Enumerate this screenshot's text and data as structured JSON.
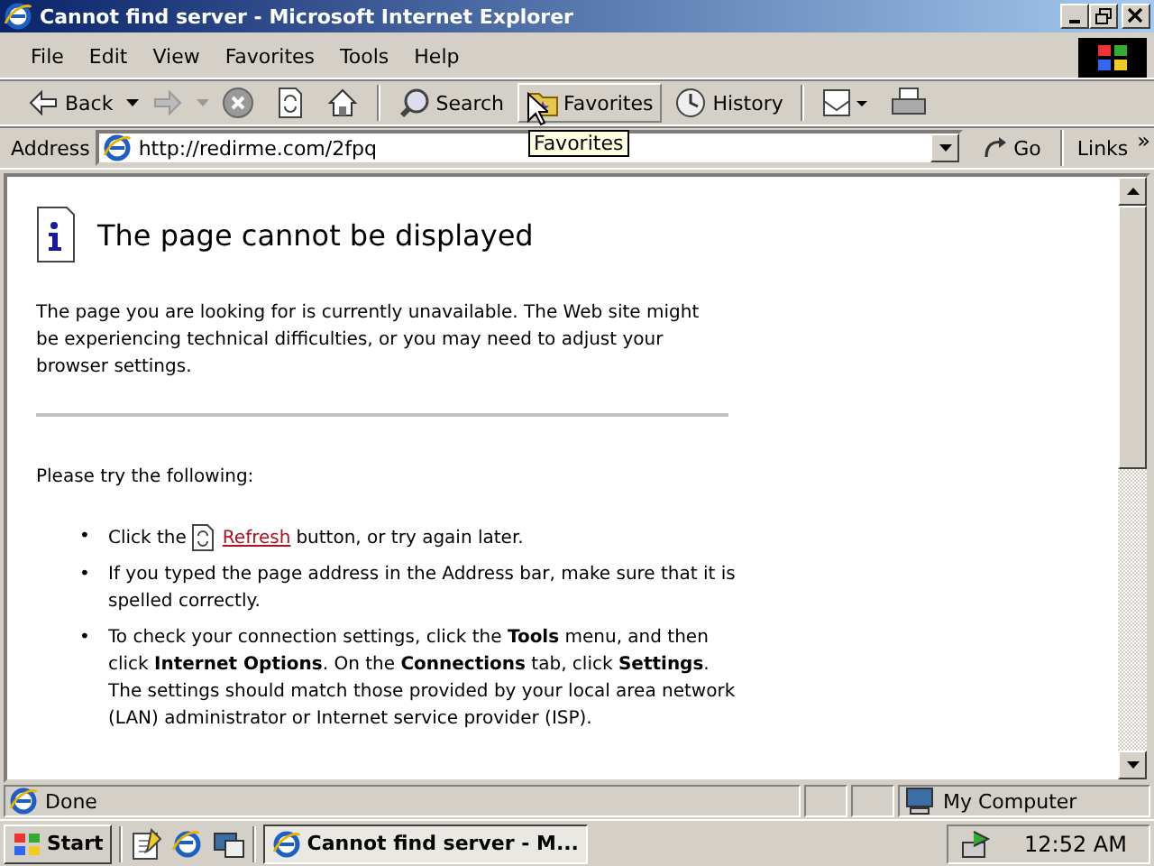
{
  "window": {
    "title": "Cannot find server - Microsoft Internet Explorer"
  },
  "menu": [
    "File",
    "Edit",
    "View",
    "Favorites",
    "Tools",
    "Help"
  ],
  "toolbar": [
    {
      "kind": "back",
      "label": "Back"
    },
    {
      "kind": "forward"
    },
    {
      "kind": "stop"
    },
    {
      "kind": "refresh"
    },
    {
      "kind": "home"
    },
    {
      "kind": "search",
      "label": "Search"
    },
    {
      "kind": "favorites",
      "label": "Favorites",
      "tooltip": "Favorites"
    },
    {
      "kind": "history",
      "label": "History"
    },
    {
      "kind": "mail"
    },
    {
      "kind": "print"
    }
  ],
  "address": {
    "label": "Address",
    "value": "http://redirme.com/2fpq",
    "go": "Go",
    "links": "Links",
    "more": "»"
  },
  "page": {
    "heading": "The page cannot be displayed",
    "intro": "The page you are looking for is currently unavailable. The Web site might be experiencing technical difficulties, or you may need to adjust your browser settings.",
    "try": "Please try the following:",
    "items": [
      {
        "kind": "refresh",
        "marker": "•",
        "before": "Click the",
        "link": "Refresh",
        "after": "button, or try again later."
      },
      {
        "kind": "text",
        "marker": "•",
        "text": "If you typed the page address in the Address bar, make sure that it is spelled correctly."
      },
      {
        "kind": "text",
        "marker": "•",
        "text": "To check your connection settings, click the **Tools** menu, and then click **Internet Options**. On the **Connections** tab, click **Settings**. The settings should match those provided by your local area network (LAN) administrator or Internet service provider (ISP)."
      }
    ]
  },
  "status": {
    "text": "Done",
    "zone": "My Computer"
  },
  "taskbar": {
    "start": "Start",
    "tasks": [
      {
        "label": "Cannot find server - M...",
        "selected": true
      }
    ],
    "clock": "12:52 AM"
  }
}
